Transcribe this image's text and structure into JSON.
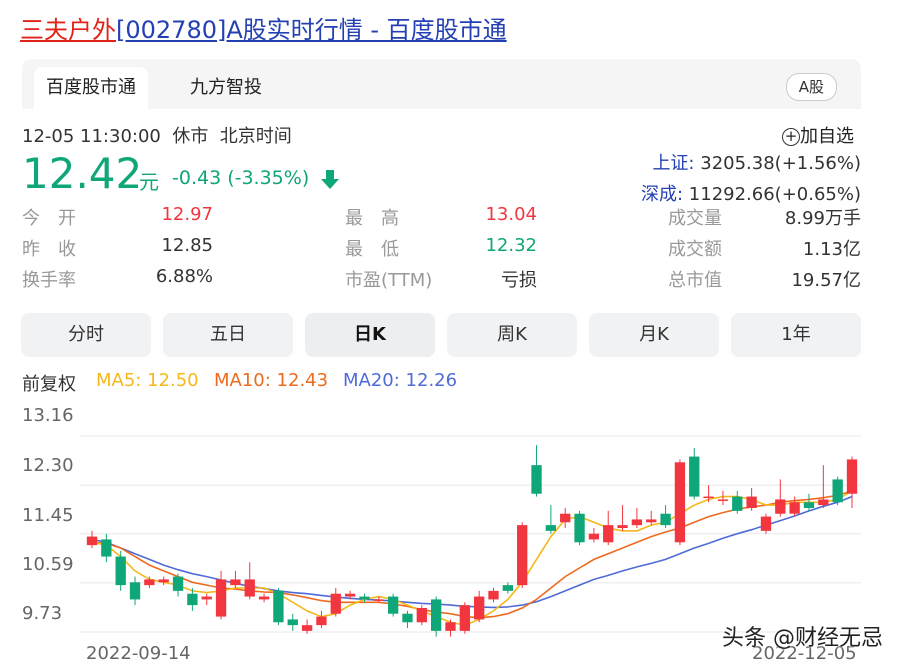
{
  "title": {
    "stock_name": "三夫户外",
    "rest": "[002780]A股实时行情 - 百度股市通"
  },
  "tabs": [
    {
      "label": "百度股市通",
      "active": true
    },
    {
      "label": "九方智投",
      "active": false
    }
  ],
  "market_pill": "A股",
  "status": {
    "time": "12-05 11:30:00",
    "state": "休市",
    "zone": "北京时间"
  },
  "add_watch": "加自选",
  "price": {
    "value": "12.42",
    "unit": "元",
    "change": "-0.43 (-3.35%)",
    "direction": "down"
  },
  "indices": [
    {
      "name": "上证:",
      "value": "3205.38(+1.56%)"
    },
    {
      "name": "深成:",
      "value": "11292.66(+0.65%)"
    }
  ],
  "stats": [
    {
      "label": "今　开",
      "value": "12.97",
      "color": "#f2363f"
    },
    {
      "label": "最　高",
      "value": "13.04",
      "color": "#f2363f"
    },
    {
      "label": "成交量",
      "value": "8.99万手",
      "color": "#333333"
    },
    {
      "label": "昨　收",
      "value": "12.85",
      "color": "#333333"
    },
    {
      "label": "最　低",
      "value": "12.32",
      "color": "#0fa679"
    },
    {
      "label": "成交额",
      "value": "1.13亿",
      "color": "#333333"
    },
    {
      "label": "换手率",
      "value": "6.88%",
      "color": "#333333"
    },
    {
      "label": "市盈(TTM)",
      "value": "亏损",
      "color": "#333333"
    },
    {
      "label": "总市值",
      "value": "19.57亿",
      "color": "#333333"
    }
  ],
  "periods": [
    {
      "label": "分时",
      "active": false
    },
    {
      "label": "五日",
      "active": false
    },
    {
      "label": "日K",
      "active": true
    },
    {
      "label": "周K",
      "active": false
    },
    {
      "label": "月K",
      "active": false
    },
    {
      "label": "1年",
      "active": false
    }
  ],
  "adjust_label": "前复权",
  "ma_legend": [
    {
      "label": "MA5: 12.50",
      "color": "#f5b81a"
    },
    {
      "label": "MA10: 12.43",
      "color": "#ee6a1e"
    },
    {
      "label": "MA20: 12.26",
      "color": "#4f6bd8"
    }
  ],
  "watermark": "头条 @财经无忌",
  "colors": {
    "up": "#f2363f",
    "down": "#0fa679",
    "accent": "#2440b3"
  },
  "chart_data": {
    "type": "candlestick",
    "y_ticks": [
      "13.16",
      "12.30",
      "11.45",
      "10.59",
      "9.73"
    ],
    "ylim": [
      9.73,
      13.16
    ],
    "x_labels": [
      "2022-09-14",
      "2022-12-05"
    ],
    "candles": [
      {
        "o": 11.25,
        "c": 11.4,
        "h": 11.5,
        "l": 11.2
      },
      {
        "o": 11.35,
        "c": 11.05,
        "h": 11.45,
        "l": 10.95
      },
      {
        "o": 11.05,
        "c": 10.55,
        "h": 11.15,
        "l": 10.45
      },
      {
        "o": 10.6,
        "c": 10.3,
        "h": 10.7,
        "l": 10.2
      },
      {
        "o": 10.55,
        "c": 10.65,
        "h": 10.7,
        "l": 10.5
      },
      {
        "o": 10.6,
        "c": 10.65,
        "h": 10.7,
        "l": 10.55
      },
      {
        "o": 10.7,
        "c": 10.45,
        "h": 10.75,
        "l": 10.35
      },
      {
        "o": 10.4,
        "c": 10.2,
        "h": 10.5,
        "l": 10.1
      },
      {
        "o": 10.3,
        "c": 10.35,
        "h": 10.4,
        "l": 10.2
      },
      {
        "o": 10.0,
        "c": 10.65,
        "h": 10.8,
        "l": 9.95
      },
      {
        "o": 10.55,
        "c": 10.65,
        "h": 10.8,
        "l": 10.5
      },
      {
        "o": 10.35,
        "c": 10.65,
        "h": 10.95,
        "l": 10.3
      },
      {
        "o": 10.3,
        "c": 10.35,
        "h": 10.4,
        "l": 10.25
      },
      {
        "o": 10.45,
        "c": 9.9,
        "h": 10.5,
        "l": 9.85
      },
      {
        "o": 9.95,
        "c": 9.85,
        "h": 10.05,
        "l": 9.75
      },
      {
        "o": 9.75,
        "c": 9.85,
        "h": 9.95,
        "l": 9.7
      },
      {
        "o": 9.85,
        "c": 10.0,
        "h": 10.1,
        "l": 9.8
      },
      {
        "o": 10.05,
        "c": 10.4,
        "h": 10.5,
        "l": 10.0
      },
      {
        "o": 10.35,
        "c": 10.4,
        "h": 10.45,
        "l": 10.3
      },
      {
        "o": 10.35,
        "c": 10.3,
        "h": 10.4,
        "l": 10.25
      },
      {
        "o": 10.3,
        "c": 10.3,
        "h": 10.35,
        "l": 10.25
      },
      {
        "o": 10.35,
        "c": 10.05,
        "h": 10.4,
        "l": 10.0
      },
      {
        "o": 10.05,
        "c": 9.9,
        "h": 10.1,
        "l": 9.8
      },
      {
        "o": 9.9,
        "c": 10.15,
        "h": 10.2,
        "l": 9.85
      },
      {
        "o": 10.3,
        "c": 9.75,
        "h": 10.35,
        "l": 9.65
      },
      {
        "o": 9.75,
        "c": 9.9,
        "h": 9.95,
        "l": 9.65
      },
      {
        "o": 9.75,
        "c": 10.2,
        "h": 10.25,
        "l": 9.7
      },
      {
        "o": 9.95,
        "c": 10.35,
        "h": 10.45,
        "l": 9.9
      },
      {
        "o": 10.3,
        "c": 10.45,
        "h": 10.5,
        "l": 10.25
      },
      {
        "o": 10.55,
        "c": 10.45,
        "h": 10.6,
        "l": 10.4
      },
      {
        "o": 10.55,
        "c": 11.6,
        "h": 11.65,
        "l": 10.5
      },
      {
        "o": 12.65,
        "c": 12.15,
        "h": 13.0,
        "l": 12.1
      },
      {
        "o": 11.6,
        "c": 11.5,
        "h": 11.95,
        "l": 11.45
      },
      {
        "o": 11.65,
        "c": 11.8,
        "h": 11.9,
        "l": 11.55
      },
      {
        "o": 11.8,
        "c": 11.3,
        "h": 11.85,
        "l": 11.25
      },
      {
        "o": 11.35,
        "c": 11.45,
        "h": 11.55,
        "l": 11.3
      },
      {
        "o": 11.3,
        "c": 11.6,
        "h": 11.85,
        "l": 11.25
      },
      {
        "o": 11.55,
        "c": 11.6,
        "h": 11.95,
        "l": 11.5
      },
      {
        "o": 11.6,
        "c": 11.7,
        "h": 11.9,
        "l": 11.55
      },
      {
        "o": 11.65,
        "c": 11.7,
        "h": 11.85,
        "l": 11.6
      },
      {
        "o": 11.8,
        "c": 11.6,
        "h": 11.95,
        "l": 11.55
      },
      {
        "o": 11.3,
        "c": 12.7,
        "h": 12.75,
        "l": 11.25
      },
      {
        "o": 12.8,
        "c": 12.1,
        "h": 12.95,
        "l": 12.05
      },
      {
        "o": 12.1,
        "c": 12.1,
        "h": 12.3,
        "l": 12.0
      },
      {
        "o": 12.05,
        "c": 12.05,
        "h": 12.2,
        "l": 11.95
      },
      {
        "o": 12.1,
        "c": 11.85,
        "h": 12.2,
        "l": 11.8
      },
      {
        "o": 11.9,
        "c": 12.1,
        "h": 12.25,
        "l": 11.85
      },
      {
        "o": 11.5,
        "c": 11.75,
        "h": 11.8,
        "l": 11.45
      },
      {
        "o": 11.8,
        "c": 12.05,
        "h": 12.4,
        "l": 11.75
      },
      {
        "o": 11.8,
        "c": 12.0,
        "h": 12.1,
        "l": 11.75
      },
      {
        "o": 12.0,
        "c": 11.9,
        "h": 12.15,
        "l": 11.85
      },
      {
        "o": 11.95,
        "c": 12.05,
        "h": 12.65,
        "l": 11.9
      },
      {
        "o": 12.4,
        "c": 12.0,
        "h": 12.45,
        "l": 11.95
      },
      {
        "o": 12.15,
        "c": 12.75,
        "h": 12.8,
        "l": 11.9
      }
    ],
    "ma5": [
      11.3,
      11.25,
      11.05,
      10.8,
      10.65,
      10.6,
      10.55,
      10.45,
      10.42,
      10.45,
      10.5,
      10.5,
      10.5,
      10.4,
      10.25,
      10.1,
      10.0,
      10.05,
      10.2,
      10.3,
      10.35,
      10.3,
      10.2,
      10.1,
      10.0,
      9.9,
      9.85,
      9.95,
      10.1,
      10.3,
      10.6,
      11.0,
      11.4,
      11.7,
      11.75,
      11.65,
      11.55,
      11.5,
      11.5,
      11.6,
      11.65,
      11.8,
      11.95,
      12.05,
      12.1,
      12.1,
      12.05,
      11.95,
      11.95,
      12.0,
      12.0,
      12.0,
      12.05,
      12.2
    ],
    "ma10": [
      11.3,
      11.28,
      11.2,
      11.05,
      10.9,
      10.8,
      10.7,
      10.6,
      10.55,
      10.5,
      10.48,
      10.45,
      10.43,
      10.42,
      10.38,
      10.33,
      10.28,
      10.25,
      10.25,
      10.25,
      10.25,
      10.22,
      10.18,
      10.12,
      10.08,
      10.05,
      10.0,
      9.98,
      10.0,
      10.05,
      10.15,
      10.3,
      10.5,
      10.7,
      10.85,
      11.0,
      11.1,
      11.2,
      11.3,
      11.4,
      11.48,
      11.55,
      11.65,
      11.75,
      11.82,
      11.88,
      11.92,
      11.95,
      12.0,
      12.03,
      12.05,
      12.08,
      12.12,
      12.2
    ],
    "ma20": [
      11.35,
      11.3,
      11.2,
      11.1,
      11.0,
      10.9,
      10.82,
      10.75,
      10.7,
      10.64,
      10.58,
      10.53,
      10.49,
      10.45,
      10.42,
      10.4,
      10.37,
      10.34,
      10.32,
      10.3,
      10.29,
      10.27,
      10.25,
      10.23,
      10.22,
      10.2,
      10.18,
      10.17,
      10.16,
      10.17,
      10.2,
      10.26,
      10.35,
      10.45,
      10.55,
      10.65,
      10.72,
      10.8,
      10.87,
      10.93,
      11.0,
      11.1,
      11.2,
      11.28,
      11.37,
      11.45,
      11.52,
      11.6,
      11.68,
      11.76,
      11.85,
      11.93,
      12.0,
      12.1
    ]
  }
}
